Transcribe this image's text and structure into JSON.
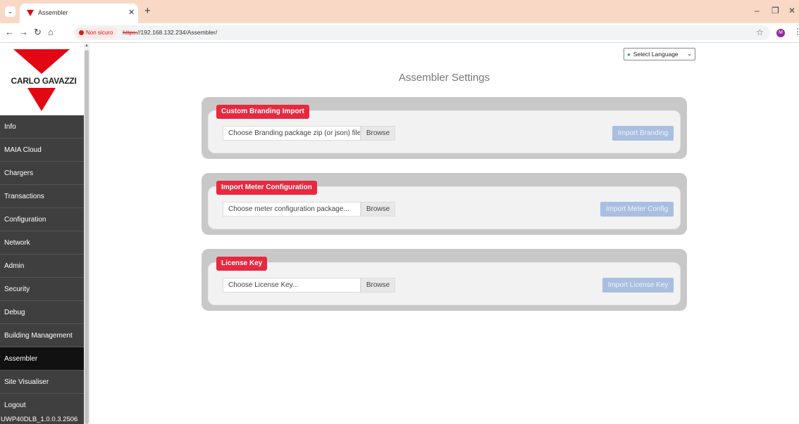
{
  "browser": {
    "tab_title": "Assembler",
    "security_label": "Non sicuro",
    "url_protocol": "https:",
    "url_rest": "//192.168.132.234/Assembler/",
    "avatar_letter": "M"
  },
  "sidebar": {
    "logo_text": "CARLO GAVAZZI",
    "items": [
      {
        "label": "Info"
      },
      {
        "label": "MAIA Cloud"
      },
      {
        "label": "Chargers"
      },
      {
        "label": "Transactions"
      },
      {
        "label": "Configuration"
      },
      {
        "label": "Network"
      },
      {
        "label": "Admin"
      },
      {
        "label": "Security"
      },
      {
        "label": "Debug"
      },
      {
        "label": "Building Management"
      },
      {
        "label": "Assembler",
        "active": true
      },
      {
        "label": "Site Visualiser"
      },
      {
        "label": "Logout"
      }
    ],
    "version": "UWP40DLB_1.0.0.3.2506"
  },
  "main": {
    "language_select": "Select Language",
    "title": "Assembler Settings",
    "panels": [
      {
        "badge": "Custom Branding Import",
        "file_placeholder": "Choose Branding package zip (or json) file...",
        "browse_label": "Browse",
        "import_label": "Import Branding"
      },
      {
        "badge": "Import Meter Configuration",
        "file_placeholder": "Choose meter configuration package...",
        "browse_label": "Browse",
        "import_label": "Import Meter Config"
      },
      {
        "badge": "License Key",
        "file_placeholder": "Choose License Key...",
        "browse_label": "Browse",
        "import_label": "Import License Key"
      }
    ]
  }
}
